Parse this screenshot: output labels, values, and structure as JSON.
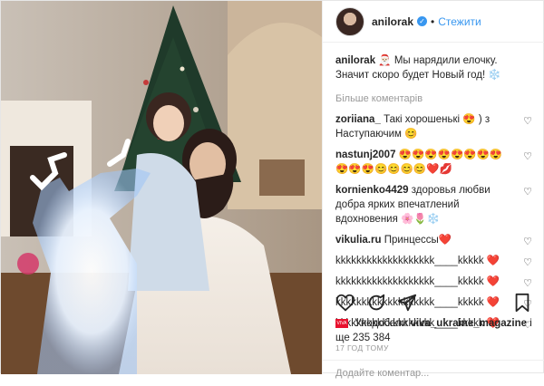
{
  "post": {
    "username": "anilorak",
    "verified": true,
    "follow_label": "Стежити",
    "caption": {
      "user": "anilorak",
      "text": "🎅🏻 Мы нарядили елочку. Значит скоро будет Новый год! ❄️"
    },
    "more_comments_label": "Більше коментарів",
    "comments": [
      {
        "user": "zoriiana_",
        "text": "Такі хорошенькі 😍 ) з Наступаючим 😊"
      },
      {
        "user": "nastunj2007",
        "text": "😍😍😍😍😍😍😍😍😍😍😍😊😊😊😊❤️💋"
      },
      {
        "user": "kornienko4429",
        "text": "здоровья любви добра ярких впечатлений вдохновения 🌸🌷❄️"
      },
      {
        "user": "vikulia.ru",
        "text": "Принцессы❤️"
      },
      {
        "user": "",
        "text": "kkkkkkkkkkkkkkkkkkk____kkkkk ❤️"
      },
      {
        "user": "",
        "text": "kkkkkkkkkkkkkkkkkkk____kkkkk ❤️"
      },
      {
        "user": "",
        "text": "kkkkkkkkkkkkkkkkkkk____kkkkk ❤️"
      },
      {
        "user": "",
        "text": "kkkkkkkkkkkkkkkkkkk____kkkkk ❤️"
      }
    ],
    "likes": {
      "prefix": "Уподобали",
      "user": "viva_ukraine_magazine",
      "suffix": "і ще 235 384"
    },
    "timestamp": "17 ГОД ТОМУ",
    "add_comment_placeholder": "Додайте коментар..."
  },
  "icons": {
    "verified": "verified-badge-icon",
    "heart": "heart-icon",
    "comment": "comment-bubble-icon",
    "share": "share-arrow-icon",
    "bookmark": "bookmark-icon"
  },
  "colors": {
    "link_blue": "#3897f0",
    "muted": "#999999",
    "border": "#efefef"
  }
}
